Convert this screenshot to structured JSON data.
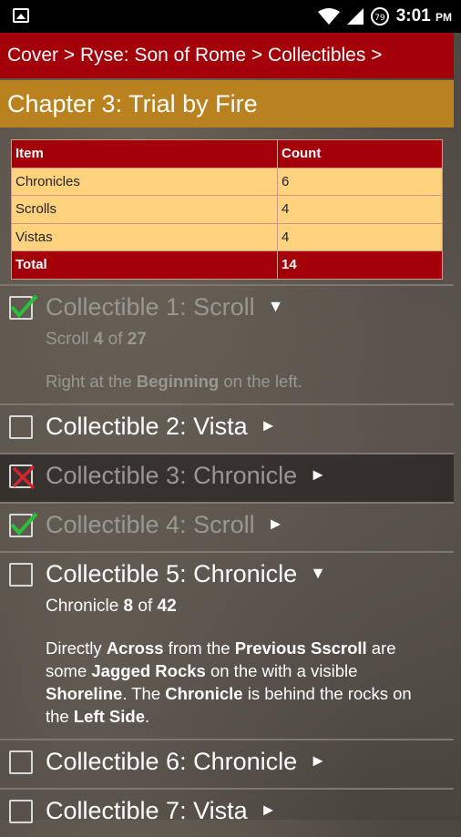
{
  "status": {
    "time": "3:01",
    "ampm": "PM",
    "battery": "79"
  },
  "breadcrumb": "Cover > Ryse: Son of Rome > Collectibles >",
  "chapter_title": "Chapter 3: Trial by Fire",
  "summary": {
    "header": [
      "Item",
      "Count"
    ],
    "rows": [
      [
        "Chronicles",
        "6"
      ],
      [
        "Scrolls",
        "4"
      ],
      [
        "Vistas",
        "4"
      ]
    ],
    "total": [
      "Total",
      "14"
    ]
  },
  "collectibles": [
    {
      "title": "Collectible 1: Scroll",
      "sub_a": "Scroll ",
      "sub_num": "4",
      "sub_b": " of ",
      "sub_tot": "27",
      "d1": "Right at the ",
      "d1b": "Beginning",
      "d1c": " on the left."
    },
    {
      "title": "Collectible 2: Vista"
    },
    {
      "title": "Collectible 3: Chronicle"
    },
    {
      "title": "Collectible 4: Scroll"
    },
    {
      "title": "Collectible 5: Chronicle",
      "sub_a": "Chronicle ",
      "sub_num": "8",
      "sub_b": " of ",
      "sub_tot": "42",
      "p": [
        "Directly ",
        "Across",
        " from the ",
        "Previous Sscroll",
        " are some ",
        "Jagged Rocks",
        " on the with a visible ",
        "Shoreline",
        ". The ",
        "Chronicle",
        " is behind the rocks on the ",
        "Left Side",
        "."
      ]
    },
    {
      "title": "Collectible 6: Chronicle"
    },
    {
      "title": "Collectible 7: Vista"
    }
  ],
  "arrows": {
    "expanded": "▼",
    "collapsed": "►"
  }
}
